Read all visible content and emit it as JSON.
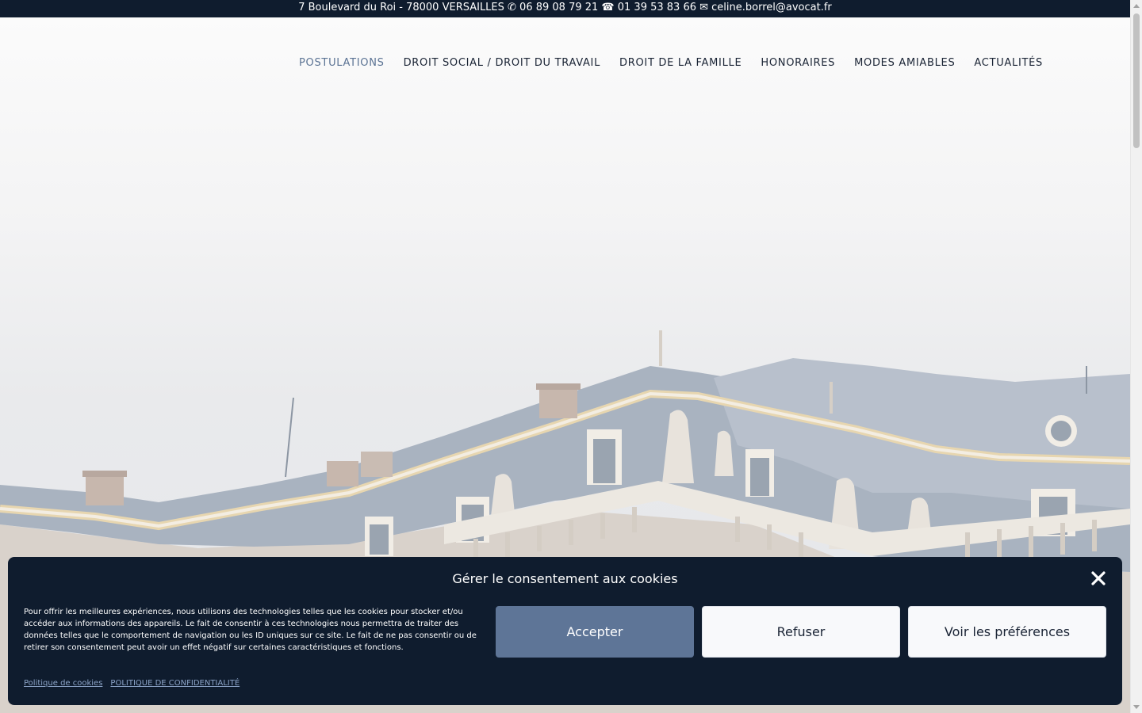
{
  "topbar": {
    "text": "7 Boulevard du Roi - 78000 VERSAILLES ✆ 06 89 08 79 21 ☎ 01 39 53 83 66 ✉ celine.borrel@avocat.fr"
  },
  "nav": {
    "items": [
      {
        "label": "POSTULATIONS",
        "active": true
      },
      {
        "label": "DROIT SOCIAL / DROIT DU TRAVAIL"
      },
      {
        "label": "DROIT DE LA FAMILLE"
      },
      {
        "label": "HONORAIRES"
      },
      {
        "label": "MODES AMIABLES"
      },
      {
        "label": "ACTUALITÉS"
      }
    ]
  },
  "hero": {
    "image_subject": "palace-rooftop"
  },
  "cookie": {
    "title": "Gérer le consentement aux cookies",
    "text": "Pour offrir les meilleures expériences, nous utilisons des technologies telles que les cookies pour stocker et/ou accéder aux informations des appareils. Le fait de consentir à ces technologies nous permettra de traiter des données telles que le comportement de navigation ou les ID uniques sur ce site. Le fait de ne pas consentir ou de retirer son consentement peut avoir un effet négatif sur certaines caractéristiques et fonctions.",
    "accept_label": "Accepter",
    "refuse_label": "Refuser",
    "prefs_label": "Voir les préférences",
    "links": {
      "cookie_policy": "Politique de cookies",
      "privacy_policy": "POLITIQUE DE CONFIDENTIALITÉ"
    },
    "close_icon": "close-icon"
  },
  "colors": {
    "topbar_bg": "#0f1c2e",
    "nav_active": "#5b7394",
    "accept_bg": "#5e7597",
    "link": "#8ba3c7"
  }
}
